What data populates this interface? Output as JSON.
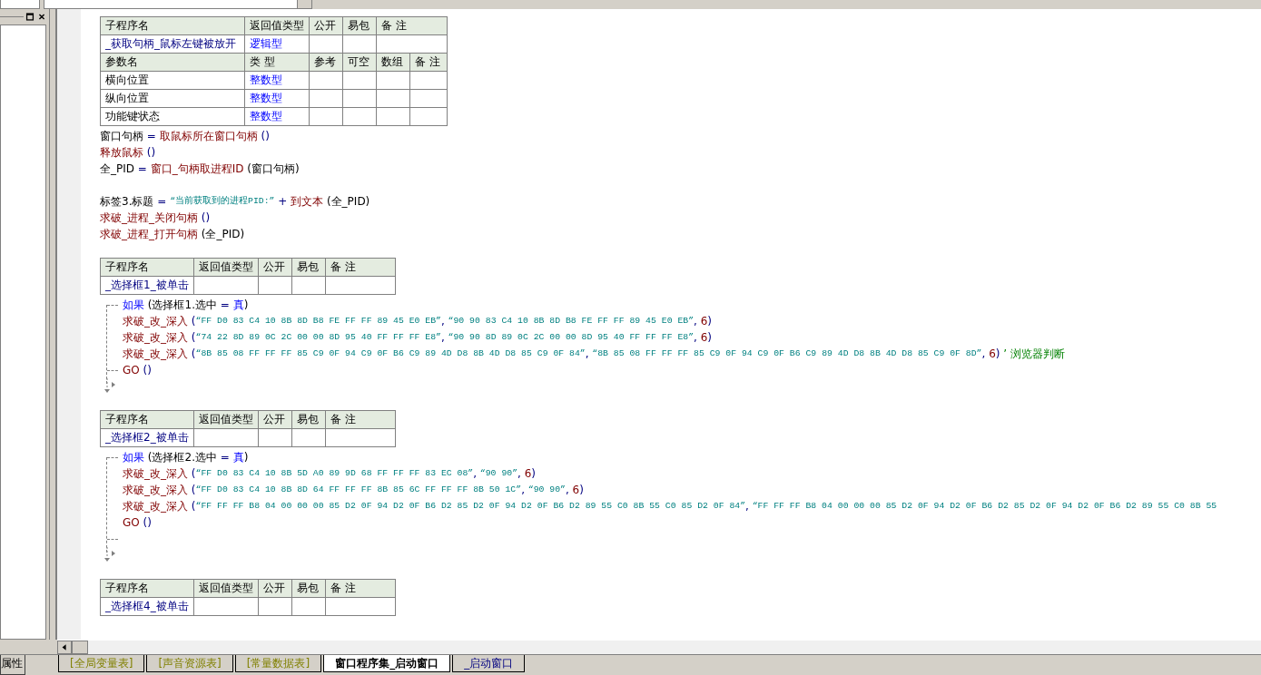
{
  "sections": [
    {
      "table": {
        "header": [
          "子程序名",
          "返回值类型",
          "公开",
          "易包",
          "备 注"
        ],
        "row": [
          "_获取句柄_鼠标左键被放开",
          "逻辑型"
        ],
        "param_header": [
          "参数名",
          "类 型",
          "参考",
          "可空",
          "数组",
          "备 注"
        ],
        "params": [
          [
            "横向位置",
            "整数型"
          ],
          [
            "纵向位置",
            "整数型"
          ],
          [
            "功能键状态",
            "整数型"
          ]
        ]
      },
      "body": [
        {
          "kind": "line",
          "segs": [
            {
              "kind": "var",
              "text": "窗口句柄"
            },
            {
              "kind": "op",
              "text": " = "
            },
            {
              "kind": "func",
              "text": "取鼠标所在窗口句柄"
            },
            {
              "kind": "op",
              "text": " ()"
            }
          ]
        },
        {
          "kind": "line",
          "segs": [
            {
              "kind": "func",
              "text": "释放鼠标"
            },
            {
              "kind": "op",
              "text": " ()"
            }
          ]
        },
        {
          "kind": "line",
          "segs": [
            {
              "kind": "var",
              "text": "全_PID"
            },
            {
              "kind": "op",
              "text": " = "
            },
            {
              "kind": "func",
              "text": "窗口_句柄取进程ID"
            },
            {
              "kind": "var",
              "text": " (窗口句柄)"
            }
          ]
        },
        {
          "kind": "blank"
        },
        {
          "kind": "line",
          "segs": [
            {
              "kind": "var",
              "text": "标签3.标题"
            },
            {
              "kind": "op",
              "text": " = "
            },
            {
              "kind": "str",
              "text": "“当前获取到的进程PID:”"
            },
            {
              "kind": "op",
              "text": " + "
            },
            {
              "kind": "func",
              "text": "到文本"
            },
            {
              "kind": "var",
              "text": " (全_PID)"
            }
          ]
        },
        {
          "kind": "line",
          "segs": [
            {
              "kind": "func",
              "text": "求破_进程_关闭句柄"
            },
            {
              "kind": "op",
              "text": " ()"
            }
          ]
        },
        {
          "kind": "line",
          "segs": [
            {
              "kind": "func",
              "text": "求破_进程_打开句柄"
            },
            {
              "kind": "var",
              "text": " (全_PID)"
            }
          ]
        }
      ]
    },
    {
      "table": {
        "header": [
          "子程序名",
          "返回值类型",
          "公开",
          "易包",
          "备 注"
        ],
        "row": [
          "_选择框1_被单击"
        ]
      },
      "body": [
        {
          "kind": "if",
          "cond": [
            {
              "kind": "kw",
              "text": "如果"
            },
            {
              "kind": "var",
              "text": " (选择框1.选中"
            },
            {
              "kind": "op",
              "text": " = "
            },
            {
              "kind": "kw",
              "text": "真"
            },
            {
              "kind": "var",
              "text": ")"
            }
          ],
          "children": [
            {
              "kind": "line",
              "segs": [
                {
                  "kind": "func",
                  "text": "求破_改_深入"
                },
                {
                  "kind": "op",
                  "text": " ("
                },
                {
                  "kind": "str",
                  "text": "“FF D0 83 C4 10 8B 8D B8 FE FF FF 89 45 E0 EB”"
                },
                {
                  "kind": "op",
                  "text": ", "
                },
                {
                  "kind": "str",
                  "text": "“90 90 83 C4 10 8B 8D B8 FE FF FF 89 45 E0 EB”"
                },
                {
                  "kind": "op",
                  "text": ", "
                },
                {
                  "kind": "num",
                  "text": "6"
                },
                {
                  "kind": "op",
                  "text": ")"
                }
              ]
            },
            {
              "kind": "line",
              "segs": [
                {
                  "kind": "func",
                  "text": "求破_改_深入"
                },
                {
                  "kind": "op",
                  "text": " ("
                },
                {
                  "kind": "str",
                  "text": "“74 22 8D 89 0C 2C 00 00 8D 95 40 FF FF FF E8”"
                },
                {
                  "kind": "op",
                  "text": ", "
                },
                {
                  "kind": "str",
                  "text": "“90 90 8D 89 0C 2C 00 00 8D 95 40 FF FF FF E8”"
                },
                {
                  "kind": "op",
                  "text": ", "
                },
                {
                  "kind": "num",
                  "text": "6"
                },
                {
                  "kind": "op",
                  "text": ")"
                }
              ]
            },
            {
              "kind": "line",
              "segs": [
                {
                  "kind": "func",
                  "text": "求破_改_深入"
                },
                {
                  "kind": "op",
                  "text": " ("
                },
                {
                  "kind": "str",
                  "text": "“8B 85 08 FF FF FF 85 C9 0F 94 C9 0F B6 C9 89 4D D8 8B 4D D8 85 C9 0F 84”"
                },
                {
                  "kind": "op",
                  "text": ", "
                },
                {
                  "kind": "str",
                  "text": "“8B 85 08 FF FF FF 85 C9 0F 94 C9 0F B6 C9 89 4D D8 8B 4D D8 85 C9 0F 8D”"
                },
                {
                  "kind": "op",
                  "text": ", "
                },
                {
                  "kind": "num",
                  "text": "6"
                },
                {
                  "kind": "op",
                  "text": ") "
                },
                {
                  "kind": "comment",
                  "text": "’ 浏览器判断"
                }
              ]
            },
            {
              "kind": "line",
              "segs": [
                {
                  "kind": "func",
                  "text": "GO"
                },
                {
                  "kind": "op",
                  "text": " ()"
                }
              ]
            }
          ]
        }
      ]
    },
    {
      "table": {
        "header": [
          "子程序名",
          "返回值类型",
          "公开",
          "易包",
          "备 注"
        ],
        "row": [
          "_选择框2_被单击"
        ]
      },
      "body": [
        {
          "kind": "if",
          "cond": [
            {
              "kind": "kw",
              "text": "如果"
            },
            {
              "kind": "var",
              "text": " (选择框2.选中"
            },
            {
              "kind": "op",
              "text": " = "
            },
            {
              "kind": "kw",
              "text": "真"
            },
            {
              "kind": "var",
              "text": ")"
            }
          ],
          "children": [
            {
              "kind": "line",
              "segs": [
                {
                  "kind": "func",
                  "text": "求破_改_深入"
                },
                {
                  "kind": "op",
                  "text": " ("
                },
                {
                  "kind": "str",
                  "text": "“FF D0 83 C4 10 8B 5D A0 89 9D 68 FF FF FF 83 EC 08”"
                },
                {
                  "kind": "op",
                  "text": ", "
                },
                {
                  "kind": "str",
                  "text": "“90 90”"
                },
                {
                  "kind": "op",
                  "text": ", "
                },
                {
                  "kind": "num",
                  "text": "6"
                },
                {
                  "kind": "op",
                  "text": ")"
                }
              ]
            },
            {
              "kind": "line",
              "segs": [
                {
                  "kind": "func",
                  "text": "求破_改_深入"
                },
                {
                  "kind": "op",
                  "text": " ("
                },
                {
                  "kind": "str",
                  "text": "“FF D0 83 C4 10 8B 8D 64 FF FF FF 8B 85 6C FF FF FF 8B 50 1C”"
                },
                {
                  "kind": "op",
                  "text": ", "
                },
                {
                  "kind": "str",
                  "text": "“90 90”"
                },
                {
                  "kind": "op",
                  "text": ", "
                },
                {
                  "kind": "num",
                  "text": "6"
                },
                {
                  "kind": "op",
                  "text": ")"
                }
              ]
            },
            {
              "kind": "line",
              "segs": [
                {
                  "kind": "func",
                  "text": "求破_改_深入"
                },
                {
                  "kind": "op",
                  "text": " ("
                },
                {
                  "kind": "str",
                  "text": "“FF FF FF B8 04 00 00 00 85 D2 0F 94 D2 0F B6 D2 85 D2 0F 94 D2 0F B6 D2 89 55 C0 8B 55 C0 85 D2 0F 84”"
                },
                {
                  "kind": "op",
                  "text": ", "
                },
                {
                  "kind": "str",
                  "text": "“FF FF FF B8 04 00 00 00 85 D2 0F 94 D2 0F B6 D2 85 D2 0F 94 D2 0F B6 D2 89 55 C0 8B 55"
                }
              ]
            },
            {
              "kind": "line",
              "segs": [
                {
                  "kind": "func",
                  "text": "GO"
                },
                {
                  "kind": "op",
                  "text": " ()"
                }
              ]
            },
            {
              "kind": "blank"
            }
          ]
        }
      ]
    },
    {
      "table": {
        "header": [
          "子程序名",
          "返回值类型",
          "公开",
          "易包",
          "备 注"
        ],
        "row": [
          "_选择框4_被单击"
        ]
      }
    }
  ],
  "left_panel": {
    "tab": "属性"
  },
  "tabs": [
    {
      "label": "[全局变量表]",
      "selected": false,
      "kind": "table"
    },
    {
      "label": "[声音资源表]",
      "selected": false,
      "kind": "table"
    },
    {
      "label": "[常量数据表]",
      "selected": false,
      "kind": "table"
    },
    {
      "label": "窗口程序集_启动窗口",
      "selected": true,
      "kind": "program"
    },
    {
      "label": "_启动窗口",
      "selected": false,
      "kind": "window"
    }
  ]
}
